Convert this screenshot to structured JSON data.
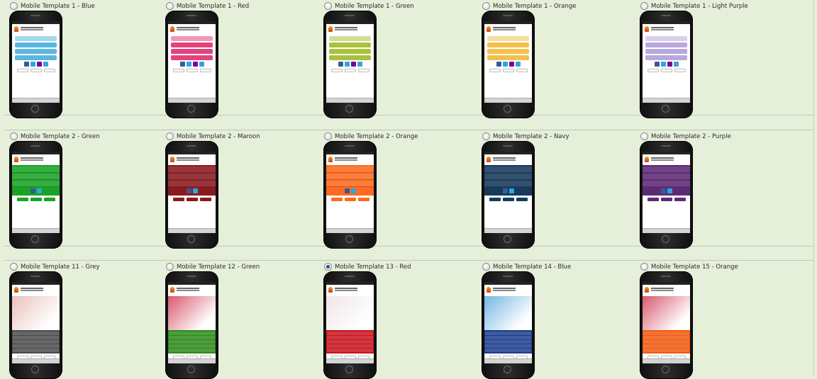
{
  "selected_index": 12,
  "templates": [
    {
      "label": "Mobile Template 1 - Blue",
      "style": "t1",
      "color": "#5bb7e0"
    },
    {
      "label": "Mobile Template 1 - Red",
      "style": "t1",
      "color": "#e4437e"
    },
    {
      "label": "Mobile Template 1 - Green",
      "style": "t1",
      "color": "#a9c23c"
    },
    {
      "label": "Mobile Template 1 - Orange",
      "style": "t1",
      "color": "#f3c04d"
    },
    {
      "label": "Mobile Template 1 - Light Purple",
      "style": "t1",
      "color": "#b9a8de"
    },
    {
      "label": "Mobile Template 2 - Green",
      "style": "t2",
      "color": "#1aa325"
    },
    {
      "label": "Mobile Template 2 - Maroon",
      "style": "t2",
      "color": "#8b1a1f"
    },
    {
      "label": "Mobile Template 2 - Orange",
      "style": "t2",
      "color": "#ff6a1e"
    },
    {
      "label": "Mobile Template 2 - Navy",
      "style": "t2",
      "color": "#163a5c"
    },
    {
      "label": "Mobile Template 2 - Purple",
      "style": "t2",
      "color": "#5e2a76"
    },
    {
      "label": "Mobile Template 11 - Grey",
      "style": "t3",
      "color": "#4b4b4b",
      "hero": "#e8c2b8"
    },
    {
      "label": "Mobile Template 12 - Green",
      "style": "t3",
      "color": "#2c8a1a",
      "hero": "#d8586e"
    },
    {
      "label": "Mobile Template 13 - Red",
      "style": "t3",
      "color": "#c8121c",
      "hero": "#f0e6e6"
    },
    {
      "label": "Mobile Template 14 - Blue",
      "style": "t3",
      "color": "#1b3c8c",
      "hero": "#73b6e2"
    },
    {
      "label": "Mobile Template 15 - Orange",
      "style": "t3",
      "color": "#f05a0e",
      "hero": "#d8586e"
    }
  ]
}
